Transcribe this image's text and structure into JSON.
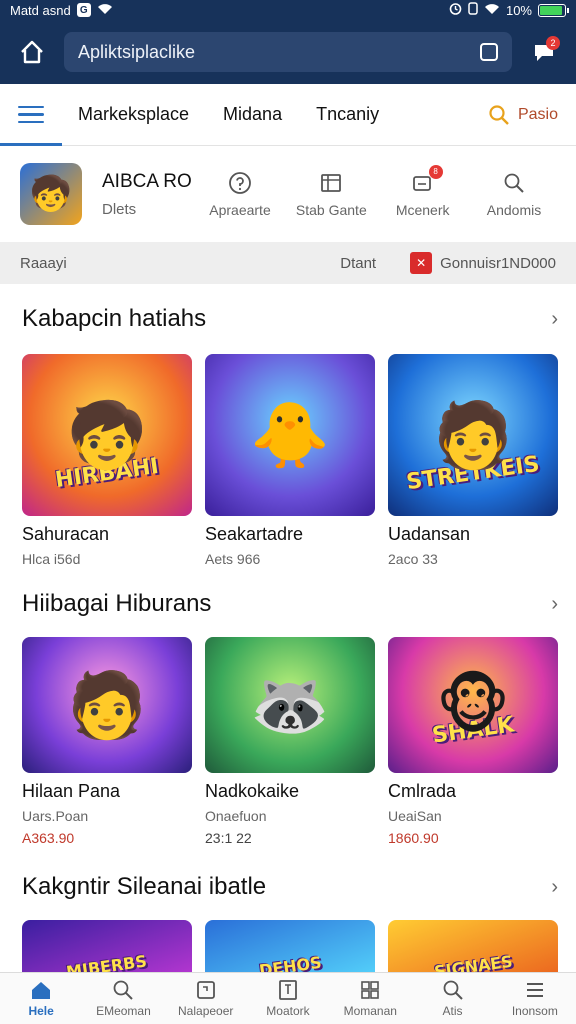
{
  "status_bar": {
    "carrier": "Matd asnd",
    "badge": "G",
    "battery_pct": "10%",
    "battery_fill": 0.9
  },
  "top_bar": {
    "address": "Apliktsiplaclike",
    "notif_count": "2"
  },
  "nav": {
    "links": [
      "Markeksplace",
      "Midana",
      "Tncaniy"
    ],
    "search_label": "Pasio"
  },
  "app": {
    "name": "AIBCA RO",
    "sub": "Dlets",
    "actions": [
      {
        "icon": "question-icon",
        "label": "Apraearte"
      },
      {
        "icon": "calendar-icon",
        "label": "Stab Gante"
      },
      {
        "icon": "message-icon",
        "label": "Mcenerk",
        "badge": "8"
      },
      {
        "icon": "search-icon",
        "label": "Andomis"
      }
    ]
  },
  "info_strip": {
    "left": "Raaayi",
    "mid": "Dtant",
    "right": "Gonnuisr1ND000"
  },
  "sections": [
    {
      "title": "Kabapcin hatiahs",
      "cards": [
        {
          "thumb_text": "HIRBAHI",
          "face": "🧒",
          "title": "Sahuracan",
          "sub": "Hlca i56d",
          "price": ""
        },
        {
          "thumb_text": "",
          "face": "🐥",
          "title": "Seakartadre",
          "sub": "Aets 966",
          "price": ""
        },
        {
          "thumb_text": "STRETKEIS",
          "face": "🧑",
          "title": "Uadansan",
          "sub": "2aco 33",
          "price": ""
        }
      ]
    },
    {
      "title": "Hiibagai Hiburans",
      "cards": [
        {
          "thumb_text": "",
          "face": "🧑",
          "title": "Hilaan Pana",
          "sub": "Uars.Poan",
          "price": "A363.90"
        },
        {
          "thumb_text": "",
          "face": "🦝",
          "title": "Nadkokaike",
          "sub": "Onaefuon",
          "price": "23:1 22"
        },
        {
          "thumb_text": "SHALK",
          "face": "🐵",
          "title": "Cmlrada",
          "sub": "UeaiSan",
          "price": "1860.90"
        }
      ]
    },
    {
      "title": "Kakgntir Sileanai ibatle",
      "cards": [
        {
          "thumb_text": "MIBERBS",
          "face": "",
          "title": "",
          "sub": "",
          "price": ""
        },
        {
          "thumb_text": "DEHOS",
          "face": "",
          "title": "",
          "sub": "",
          "price": ""
        },
        {
          "thumb_text": "SIGNAES",
          "face": "",
          "title": "",
          "sub": "",
          "price": ""
        }
      ]
    }
  ],
  "bottom_nav": [
    {
      "icon": "home-icon",
      "label": "Hele"
    },
    {
      "icon": "search-icon",
      "label": "EMeoman"
    },
    {
      "icon": "tablet-icon",
      "label": "Nalapeoer"
    },
    {
      "icon": "book-icon",
      "label": "Moatork"
    },
    {
      "icon": "grid-icon",
      "label": "Momanan"
    },
    {
      "icon": "search-icon",
      "label": "Atis"
    },
    {
      "icon": "menu-icon",
      "label": "Inonsom"
    }
  ],
  "colors": {
    "header_bg": "#17325a",
    "accent": "#2a6fbf",
    "price": "#c0392b"
  }
}
